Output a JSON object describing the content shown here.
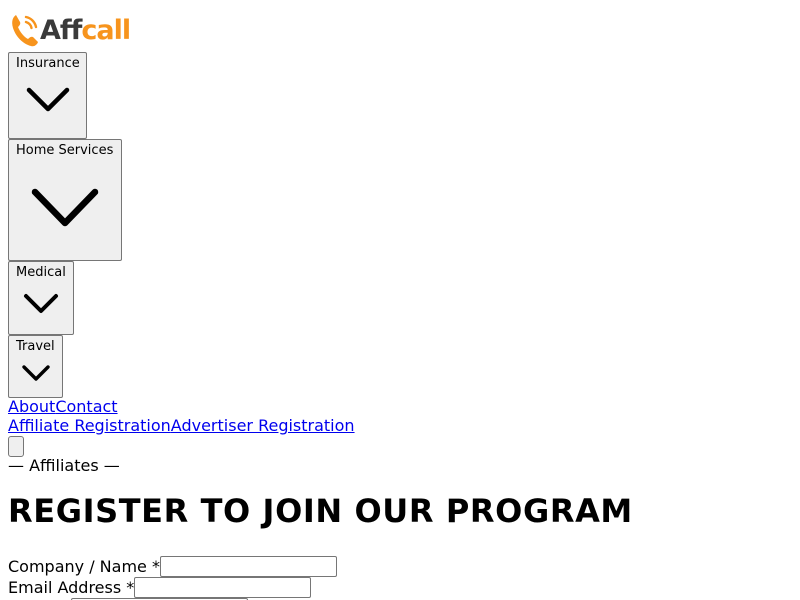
{
  "header": {
    "logo": {
      "text_part1": "Aff",
      "text_part2": "call",
      "icon": "phone-icon"
    }
  },
  "nav": {
    "dropdowns": [
      {
        "label": "Insurance",
        "icon": "chevron-down-icon"
      },
      {
        "label": "Home Services",
        "icon": "chevron-down-icon"
      },
      {
        "label": "Medical",
        "icon": "chevron-down-icon"
      },
      {
        "label": "Travel",
        "icon": "chevron-down-icon"
      }
    ],
    "links": [
      {
        "label": "About"
      },
      {
        "label": "Contact"
      }
    ],
    "registration_links": [
      {
        "label": "Affiliate Registration"
      },
      {
        "label": "Advertiser Registration"
      }
    ]
  },
  "main": {
    "eyebrow": "— Affiliates —",
    "title": "REGISTER TO JOIN OUR PROGRAM",
    "form": {
      "company_label": "Company / Name *",
      "company_value": "",
      "email_label": "Email Address *",
      "email_value": ""
    }
  },
  "colors": {
    "brand_orange": "#f7941d",
    "brand_dark": "#3a3a3a",
    "link": "#0000ee"
  }
}
